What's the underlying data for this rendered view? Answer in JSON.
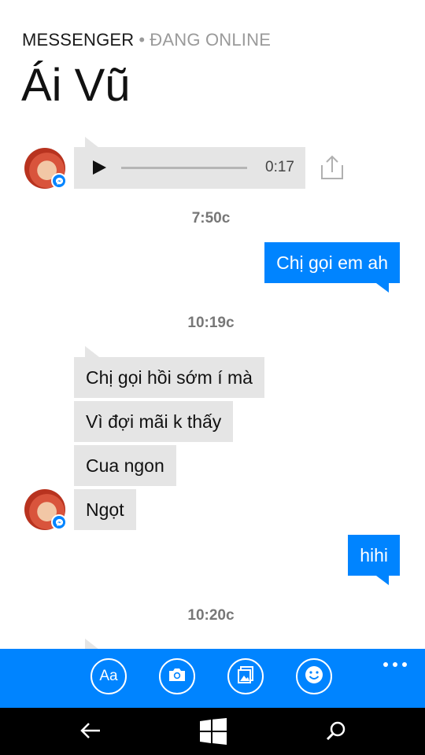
{
  "header": {
    "app_name": "MESSENGER",
    "separator": "•",
    "status": "ĐANG ONLINE",
    "contact_name": "Ái Vũ"
  },
  "conversation": {
    "audio_message": {
      "duration": "0:17"
    },
    "timestamps": [
      "7:50c",
      "10:19c",
      "10:20c"
    ],
    "outgoing": [
      "Chị gọi em ah",
      "hihi"
    ],
    "incoming": [
      "Chị gọi hồi sớm í mà",
      "Vì đợi mãi k thấy",
      "Cua ngon",
      "Ngọt"
    ]
  },
  "composer": {
    "text_button": "Aa",
    "buttons": [
      "text-format-icon",
      "camera-icon",
      "gallery-icon",
      "emoji-icon",
      "more-icon"
    ]
  },
  "colors": {
    "accent": "#0084ff",
    "incoming_bubble": "#e5e5e5",
    "nav_bar": "#000000"
  }
}
